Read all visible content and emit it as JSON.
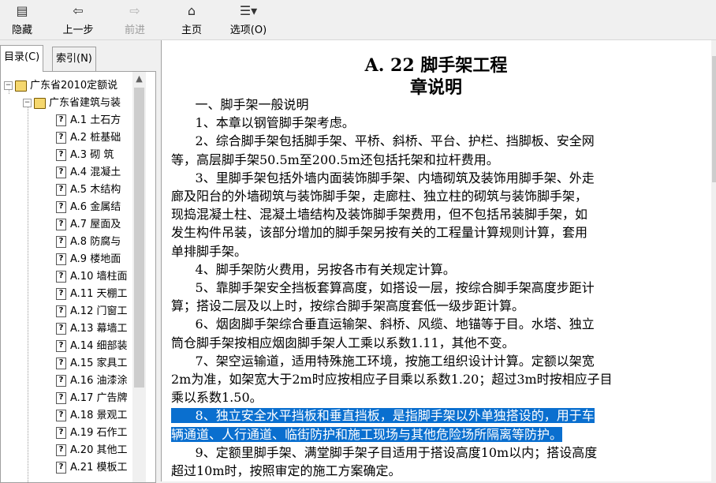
{
  "toolbar": {
    "hide": "隐藏",
    "back": "上一步",
    "forward": "前进",
    "home": "主页",
    "options": "选项(O)"
  },
  "tabs": {
    "contents": "目录(C)",
    "index": "索引(N)"
  },
  "tree": {
    "root": "广东省2010定额说",
    "child": "广东省建筑与装",
    "items": [
      "A.1  土石方",
      "A.2  桩基础",
      "A.3  砌  筑",
      "A.4  混凝土",
      "A.5  木结构",
      "A.6  金属结",
      "A.7  屋面及",
      "A.8  防腐与",
      "A.9  楼地面",
      "A.10  墙柱面",
      "A.11  天棚工",
      "A.12  门窗工",
      "A.13  幕墙工",
      "A.14  细部装",
      "A.15  家具工",
      "A.16  油漆涂",
      "A.17  广告牌",
      "A.18 景观工",
      "A.19 石作工",
      "A.20  其他工",
      "A.21  模板工"
    ]
  },
  "doc": {
    "title": "A. 22   脚手架工程",
    "subtitle": "章说明",
    "lines": [
      "      一、脚手架一般说明",
      "      1、本章以钢管脚手架考虑。",
      "      2、综合脚手架包括脚手架、平桥、斜桥、平台、护栏、挡脚板、安全网",
      "等，高层脚手架50.5m至200.5m还包括托架和拉杆费用。",
      "      3、里脚手架包括外墙内面装饰脚手架、内墙砌筑及装饰用脚手架、外走",
      "廊及阳台的外墙砌筑与装饰脚手架，走廊柱、独立柱的砌筑与装饰脚手架，",
      "现捣混凝土柱、混凝土墙结构及装饰脚手架费用，但不包括吊装脚手架，如",
      "发生构件吊装，该部分增加的脚手架另按有关的工程量计算规则计算，套用",
      "单排脚手架。",
      "      4、脚手架防火费用，另按各市有关规定计算。",
      "      5、靠脚手架安全挡板套算高度，如搭设一层，按综合脚手架高度步距计",
      "算；搭设二层及以上时，按综合脚手架高度套低一级步距计算。",
      "      6、烟囱脚手架综合垂直运输架、斜桥、风缆、地锚等于目。水塔、独立",
      "筒仓脚手架按相应烟囱脚手架人工乘以系数1.11，其他不变。",
      "      7、架空运输道，适用特殊施工环境，按施工组织设计计算。定额以架宽",
      "2m为准，如架宽大于2m时应按相应子目乘以系数1.20；超过3m时按相应子目",
      "乘以系数1.50。",
      "      8、独立安全水平挡板和垂直挡板，是指脚手架以外单独搭设的，用于车",
      "辆通道、人行通道、临街防护和施工现场与其他危险场所隔离等防护。",
      "      9、定额里脚手架、满堂脚手架子目适用于搭设高度10m以内；搭设高度",
      "超过10m时，按照审定的施工方案确定。"
    ]
  }
}
